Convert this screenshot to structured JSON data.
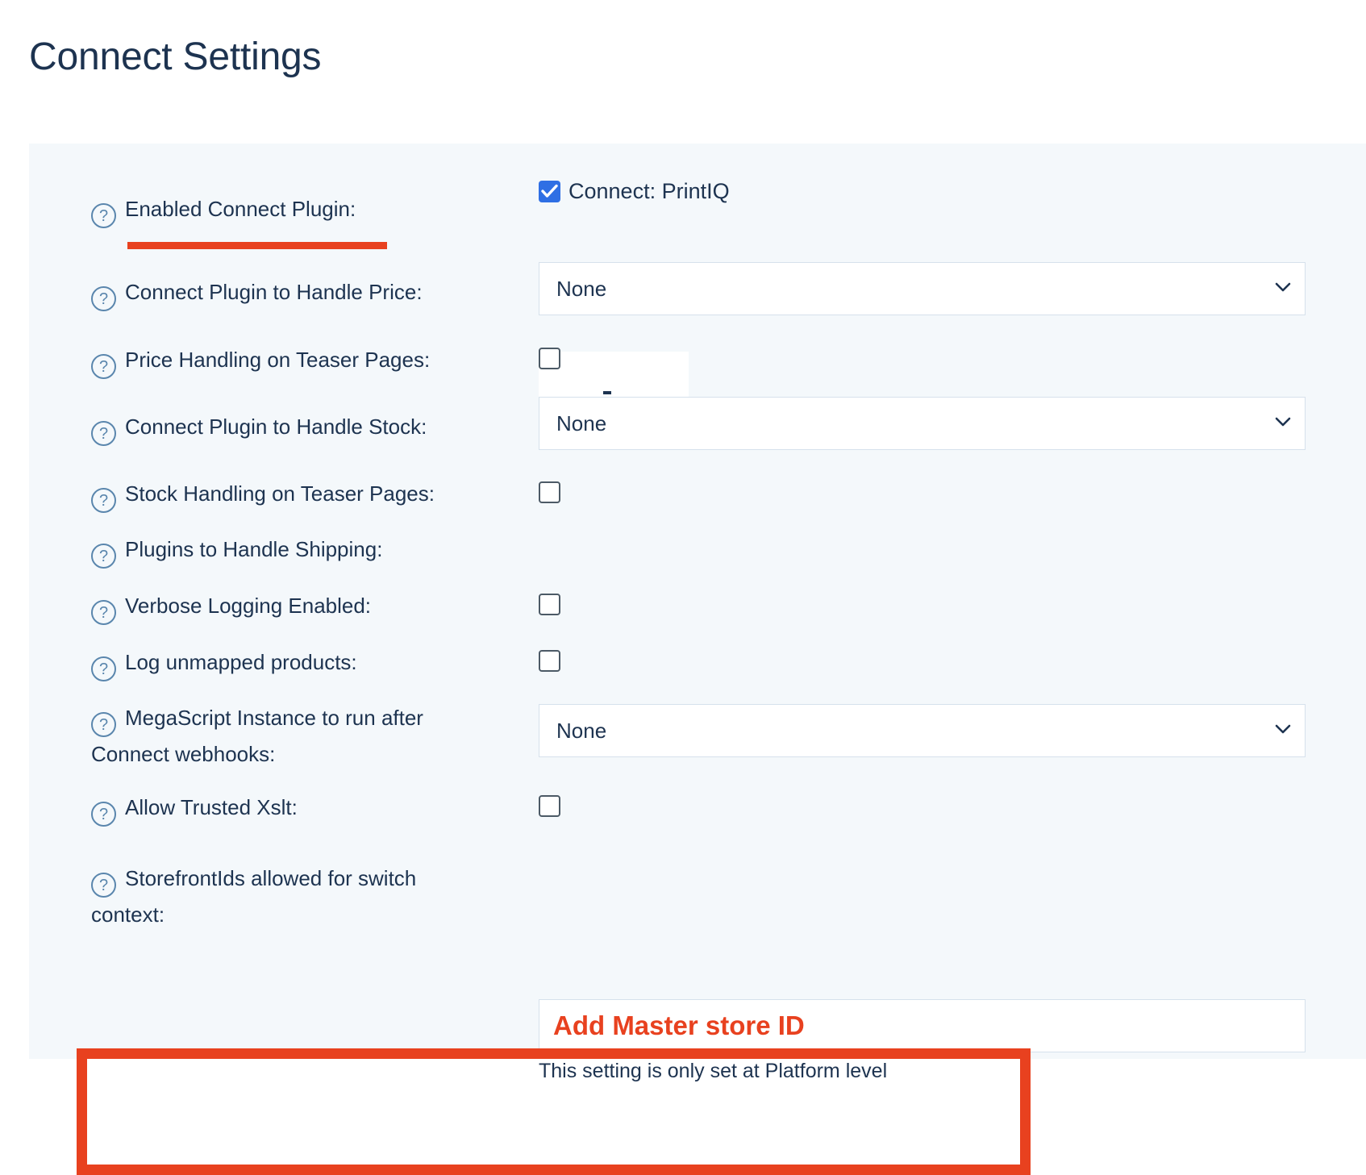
{
  "page": {
    "title": "Connect Settings"
  },
  "theme": {
    "panel_bg": "#f4f8fb",
    "text": "#1d3350",
    "accent_red": "#e8411f",
    "checkbox_blue": "#2f6fe4",
    "border": "#d6e1ec",
    "help_icon": "#5a86ad"
  },
  "icons": {
    "help": "?",
    "chevron_down": "chevron-down-icon",
    "check": "check-icon"
  },
  "rows": [
    {
      "id": "enabled-connect-plugin",
      "label": "Enabled Connect Plugin:",
      "control": "checkbox-with-label",
      "checkbox_label": "Connect: PrintIQ",
      "checked": true,
      "annotated_underline": true
    },
    {
      "id": "connect-plugin-handle-price",
      "label": "Connect Plugin to Handle Price:",
      "control": "select",
      "value": "None"
    },
    {
      "id": "price-handling-teaser-pages",
      "label": "Price Handling on Teaser Pages:",
      "control": "checkbox",
      "checked": false
    },
    {
      "id": "connect-plugin-handle-stock",
      "label": "Connect Plugin to Handle Stock:",
      "control": "select",
      "value": "None"
    },
    {
      "id": "stock-handling-teaser-pages",
      "label": "Stock Handling on Teaser Pages:",
      "control": "checkbox",
      "checked": false
    },
    {
      "id": "plugins-handle-shipping",
      "label": "Plugins to Handle Shipping:",
      "control": "none"
    },
    {
      "id": "verbose-logging-enabled",
      "label": "Verbose Logging Enabled:",
      "control": "checkbox",
      "checked": false
    },
    {
      "id": "log-unmapped-products",
      "label": "Log unmapped products:",
      "control": "checkbox",
      "checked": false
    },
    {
      "id": "megascript-instance",
      "label": "MegaScript Instance to run after Connect webhooks:",
      "control": "select",
      "value": "None"
    },
    {
      "id": "allow-trusted-xslt",
      "label": "Allow Trusted Xslt:",
      "control": "checkbox",
      "checked": false
    },
    {
      "id": "storefrontids-switch-context",
      "label": "StorefrontIds allowed for switch context:",
      "control": "text",
      "value": "",
      "helper": "This setting is only set at Platform level",
      "annotated_box": true
    }
  ],
  "annotations": {
    "add_master_store_id": "Add Master store ID"
  }
}
